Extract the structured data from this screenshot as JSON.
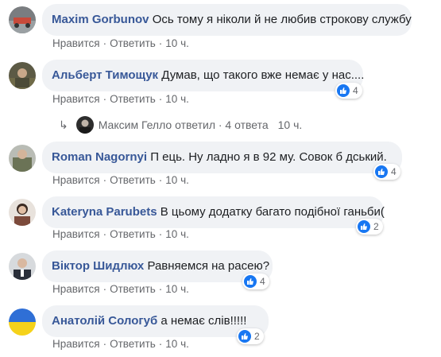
{
  "comments": [
    {
      "author": "Maxim Gorbunov",
      "text": "Ось тому я ніколи й не любив строкову службу",
      "like": "Нравится",
      "reply": "Ответить",
      "time": "10 ч.",
      "reactions": null
    },
    {
      "author": "Альберт Тимощук",
      "text": "Думав, що такого вже немає у нас....",
      "like": "Нравится",
      "reply": "Ответить",
      "time": "10 ч.",
      "reactions": "4"
    },
    {
      "author": "Roman Nagornyi",
      "text": "П  ець. Ну ладно я в 92 му. Совок б  дський.",
      "like": "Нравится",
      "reply": "Ответить",
      "time": "10 ч.",
      "reactions": "4"
    },
    {
      "author": "Kateryna Parubets",
      "text": "В цьому додатку багато подібної ганьби(",
      "like": "Нравится",
      "reply": "Ответить",
      "time": "10 ч.",
      "reactions": "2"
    },
    {
      "author": "Віктор Шидлюх",
      "text": "Равняемся на расею?",
      "like": "Нравится",
      "reply": "Ответить",
      "time": "10 ч.",
      "reactions": "4"
    },
    {
      "author": "Анатолій Сологуб",
      "text": "  а немає слів!!!!!",
      "like": "Нравится",
      "reply": "Ответить",
      "time": "10 ч.",
      "reactions": "2"
    }
  ],
  "replies_summary": {
    "text": "Максим Гелло ответил · 4 ответа",
    "time": "10 ч."
  },
  "colors": {
    "link": "#385898",
    "bubble": "#f0f2f5",
    "like": "#1877f2",
    "meta": "#65676b"
  },
  "icons": {
    "reaction": "thumbs-up-icon",
    "reply_arrow": "reply-arrow-icon"
  }
}
